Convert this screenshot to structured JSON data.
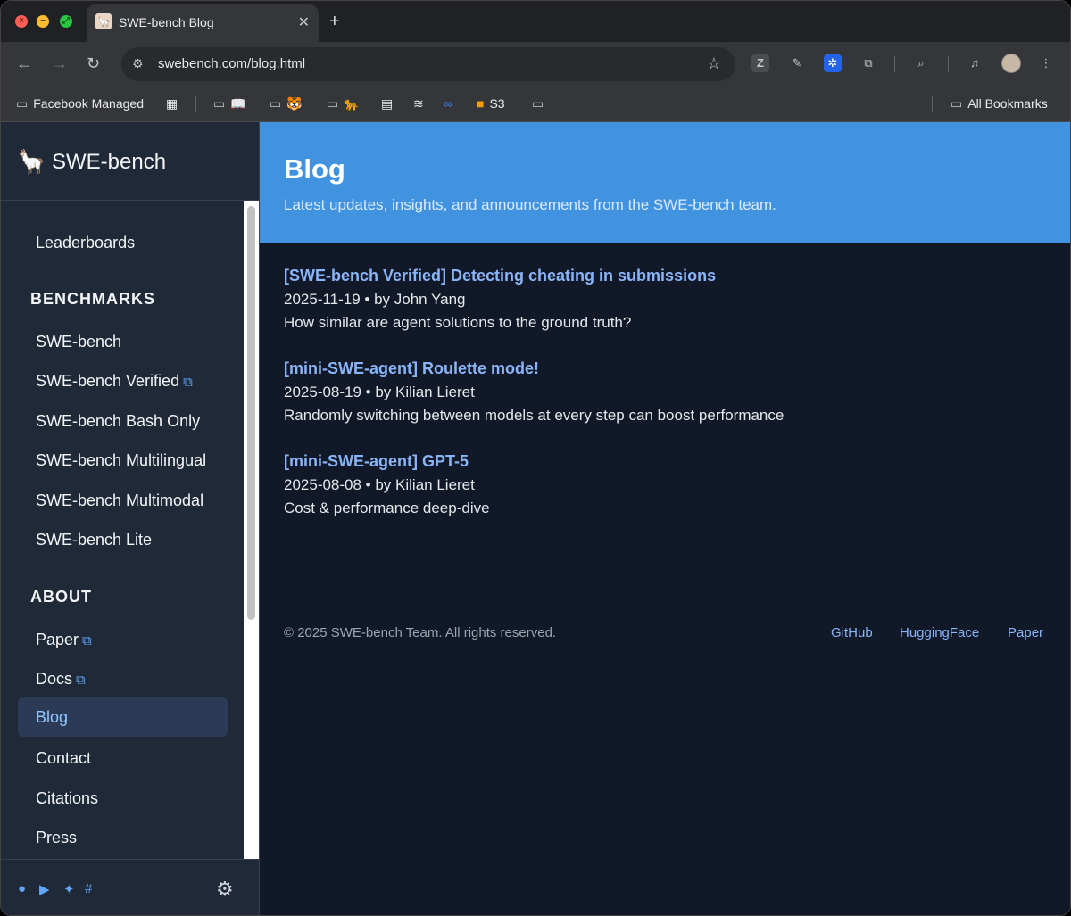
{
  "browser": {
    "tab_title": "SWE-bench Blog",
    "url": "swebench.com/blog.html",
    "bookmarks": [
      {
        "label": "Facebook Managed",
        "icon": "managed-icon"
      },
      {
        "label": "",
        "icon": "apps-grid-icon"
      },
      {
        "label": "",
        "icon": "folder-icon"
      },
      {
        "label": "",
        "icon": "folder-icon"
      },
      {
        "label": "",
        "icon": "folder-icon"
      },
      {
        "label": "S3",
        "icon": "aws-icon"
      },
      {
        "label": "",
        "icon": "folder-icon"
      }
    ],
    "all_bookmarks": "All Bookmarks"
  },
  "sidebar": {
    "brand": "SWE-bench",
    "leaderboards": "Leaderboards",
    "benchmarks_heading": "BENCHMARKS",
    "benchmarks": [
      "SWE-bench",
      "SWE-bench Verified",
      "SWE-bench Bash Only",
      "SWE-bench Multilingual",
      "SWE-bench Multimodal",
      "SWE-bench Lite"
    ],
    "about_heading": "ABOUT",
    "about": [
      "Paper",
      "Docs",
      "Blog",
      "Contact",
      "Citations",
      "Press"
    ]
  },
  "hero": {
    "title": "Blog",
    "subtitle": "Latest updates, insights, and announcements from the SWE-bench team."
  },
  "posts": [
    {
      "title": "[SWE-bench Verified] Detecting cheating in submissions",
      "meta": "2025-11-19 • by John Yang",
      "desc": "How similar are agent solutions to the ground truth?"
    },
    {
      "title": "[mini-SWE-agent] Roulette mode!",
      "meta": "2025-08-19 • by Kilian Lieret",
      "desc": "Randomly switching between models at every step can boost performance"
    },
    {
      "title": "[mini-SWE-agent] GPT-5",
      "meta": "2025-08-08 • by Kilian Lieret",
      "desc": "Cost & performance deep-dive"
    }
  ],
  "footer": {
    "copyright": "© 2025 SWE-bench Team. All rights reserved.",
    "links": [
      "GitHub",
      "HuggingFace",
      "Paper"
    ]
  },
  "colors": {
    "hero": "#4193df",
    "link": "#8ab4f8",
    "background": "#111827",
    "sidebar": "#1f2937"
  }
}
